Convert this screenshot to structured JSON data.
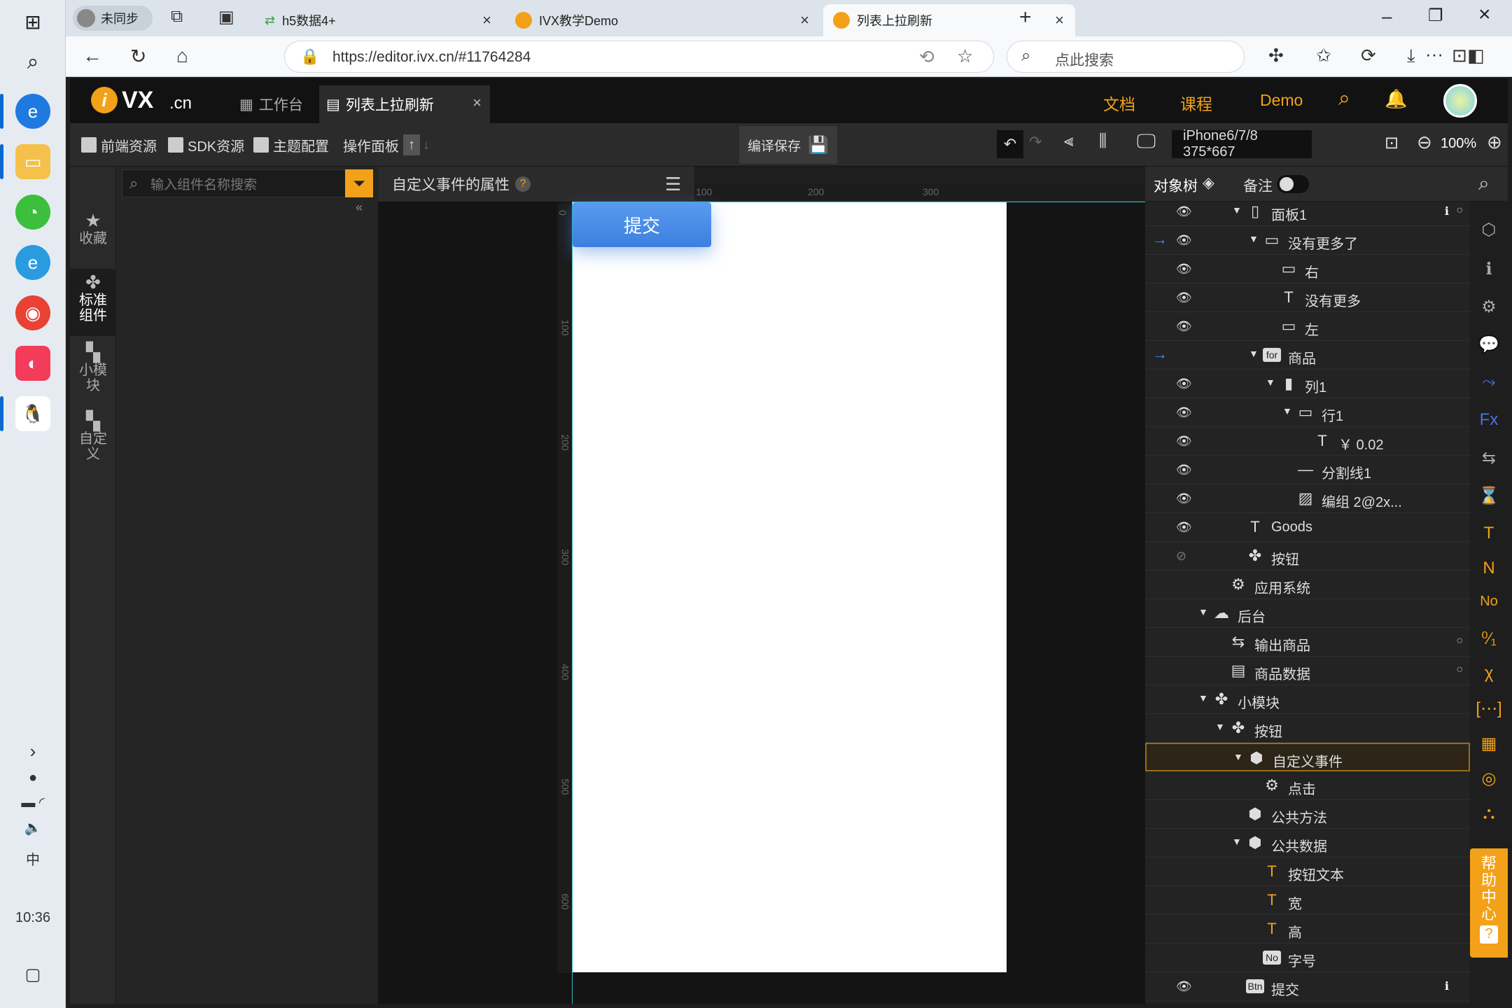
{
  "taskbar": {
    "time": "10:36",
    "ime": "中",
    "icons": [
      "windows-icon",
      "search-icon",
      "edge-icon",
      "file-explorer-icon",
      "wechat-icon",
      "ie-icon",
      "chrome-icon",
      "app-icon",
      "qq-icon"
    ]
  },
  "browser": {
    "profile": "未同步",
    "tabs": [
      {
        "title": "h5数据4+"
      },
      {
        "title": "IVX教学Demo"
      },
      {
        "title": "列表上拉刷新"
      }
    ],
    "url": "https://editor.ivx.cn/#11764284",
    "search_placeholder": "点此搜索"
  },
  "app": {
    "logo": "VX",
    "logo_suffix": ".cn",
    "tabs": [
      {
        "label": "工作台"
      },
      {
        "label": "列表上拉刷新"
      }
    ],
    "header_links": [
      "文档",
      "课程",
      "Demo"
    ],
    "toolbar": {
      "front_res": "前端资源",
      "sdk_res": "SDK资源",
      "theme": "主题配置",
      "ops": "操作面板",
      "compile_save": "编译保存",
      "device": "iPhone6/7/8 375*667",
      "zoom": "100%"
    },
    "left_nav": [
      {
        "label": "收藏"
      },
      {
        "label": "标准组件"
      },
      {
        "label": "小模块"
      },
      {
        "label": "自定义"
      }
    ],
    "search_placeholder": "输入组件名称搜索",
    "prop_title": "自定义事件的属性",
    "ruler_top": [
      "100",
      "200",
      "300"
    ],
    "ruler_left": [
      "0",
      "100",
      "200",
      "300",
      "400",
      "500",
      "600"
    ],
    "canvas_button": "提交",
    "tree_header": {
      "objects": "对象树",
      "notes": "备注"
    },
    "tree": [
      {
        "label": "面板1",
        "indent": 3
      },
      {
        "label": "没有更多了",
        "indent": 4
      },
      {
        "label": "右",
        "indent": 5
      },
      {
        "label": "没有更多",
        "indent": 5
      },
      {
        "label": "左",
        "indent": 5
      },
      {
        "label": "商品",
        "indent": 4
      },
      {
        "label": "列1",
        "indent": 5
      },
      {
        "label": "行1",
        "indent": 6
      },
      {
        "label": "￥ 0.02",
        "indent": 7
      },
      {
        "label": "分割线1",
        "indent": 6
      },
      {
        "label": "编组 2@2x...",
        "indent": 6
      },
      {
        "label": "Goods",
        "indent": 3
      },
      {
        "label": "按钮",
        "indent": 3
      },
      {
        "label": "应用系统",
        "indent": 2
      },
      {
        "label": "后台",
        "indent": 1
      },
      {
        "label": "输出商品",
        "indent": 2
      },
      {
        "label": "商品数据",
        "indent": 2
      },
      {
        "label": "小模块",
        "indent": 1
      },
      {
        "label": "按钮",
        "indent": 2
      },
      {
        "label": "自定义事件",
        "indent": 3
      },
      {
        "label": "点击",
        "indent": 4
      },
      {
        "label": "公共方法",
        "indent": 3
      },
      {
        "label": "公共数据",
        "indent": 3
      },
      {
        "label": "按钮文本",
        "indent": 4
      },
      {
        "label": "宽",
        "indent": 4
      },
      {
        "label": "高",
        "indent": 4
      },
      {
        "label": "字号",
        "indent": 4
      },
      {
        "label": "提交",
        "indent": 3
      }
    ],
    "help": "帮助中心",
    "colors": {
      "accent": "#f2a118",
      "selection": "#9a6b1d",
      "blue": "#4b8cf0"
    }
  }
}
